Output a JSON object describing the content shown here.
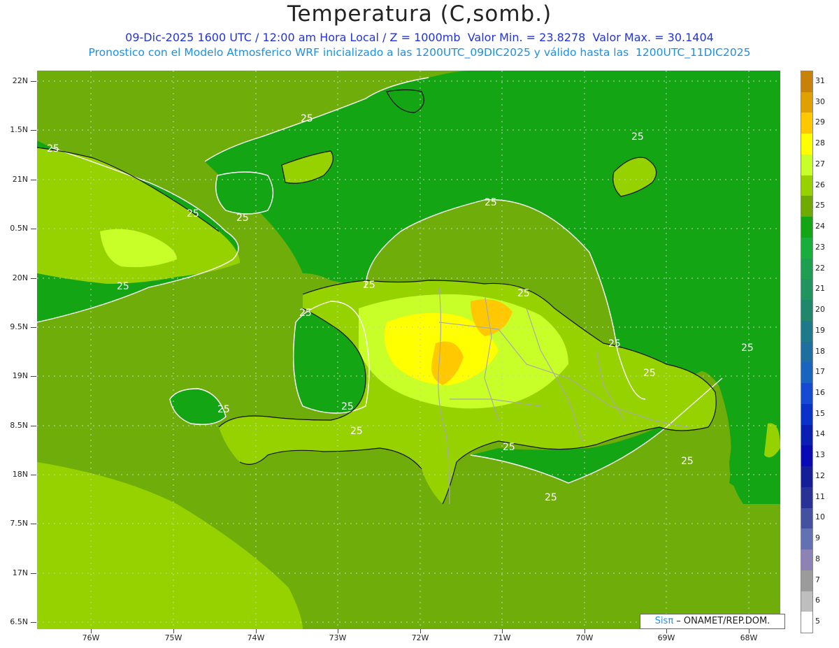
{
  "header": {
    "title": "Temperatura (C,somb.)",
    "subtitle1": "09-Dic-2025 1600 UTC / 12:00 am Hora Local / Z = 1000mb  Valor Min. = 23.8278  Valor Max. = 30.1404",
    "subtitle2": "Pronostico con el Modelo Atmosferico WRF inicializado a las 1200UTC_09DIC2025 y válido hasta las  1200UTC_11DIC2025"
  },
  "axes": {
    "lat_labels": [
      "22N",
      "1.5N",
      "21N",
      "0.5N",
      "20N",
      "9.5N",
      "19N",
      "8.5N",
      "18N",
      "7.5N",
      "17N",
      "6.5N"
    ],
    "lat_values": [
      22,
      21.5,
      21,
      20.5,
      20,
      19.5,
      19,
      18.5,
      18,
      17.5,
      17,
      16.5
    ],
    "lon_labels": [
      "76W",
      "75W",
      "74W",
      "73W",
      "72W",
      "71W",
      "70W",
      "69W",
      "68W"
    ],
    "lon_values": [
      -76,
      -75,
      -74,
      -73,
      -72,
      -71,
      -70,
      -69,
      -68
    ],
    "lat_range": [
      16.5,
      22.1
    ],
    "lon_range": [
      -76.6,
      -67.6
    ]
  },
  "contour_label": "25",
  "colorbar": {
    "labels": [
      "31",
      "30",
      "29",
      "28",
      "27",
      "26",
      "25",
      "24",
      "23",
      "22",
      "21",
      "20",
      "19",
      "18",
      "17",
      "16",
      "15",
      "14",
      "13",
      "12",
      "11",
      "10",
      "9",
      "8",
      "7",
      "6",
      "5"
    ],
    "colors": [
      "#c8820a",
      "#e0a000",
      "#ffc800",
      "#ffff00",
      "#c8ff28",
      "#96d200",
      "#6eaa00",
      "#14a514",
      "#18ae3c",
      "#1e9e50",
      "#21935e",
      "#21876c",
      "#1e7a8a",
      "#1e6ea0",
      "#1964be",
      "#144bd2",
      "#0a32c8",
      "#0a1eb4",
      "#0a0ab4",
      "#141e96",
      "#283296",
      "#4650a0",
      "#6470b4",
      "#8c82b4",
      "#9b9b9b",
      "#bebebe",
      "#ffffff"
    ]
  },
  "credit": {
    "brand": "Sisπ",
    "org": " –  ONAMET/REP.DOM."
  }
}
